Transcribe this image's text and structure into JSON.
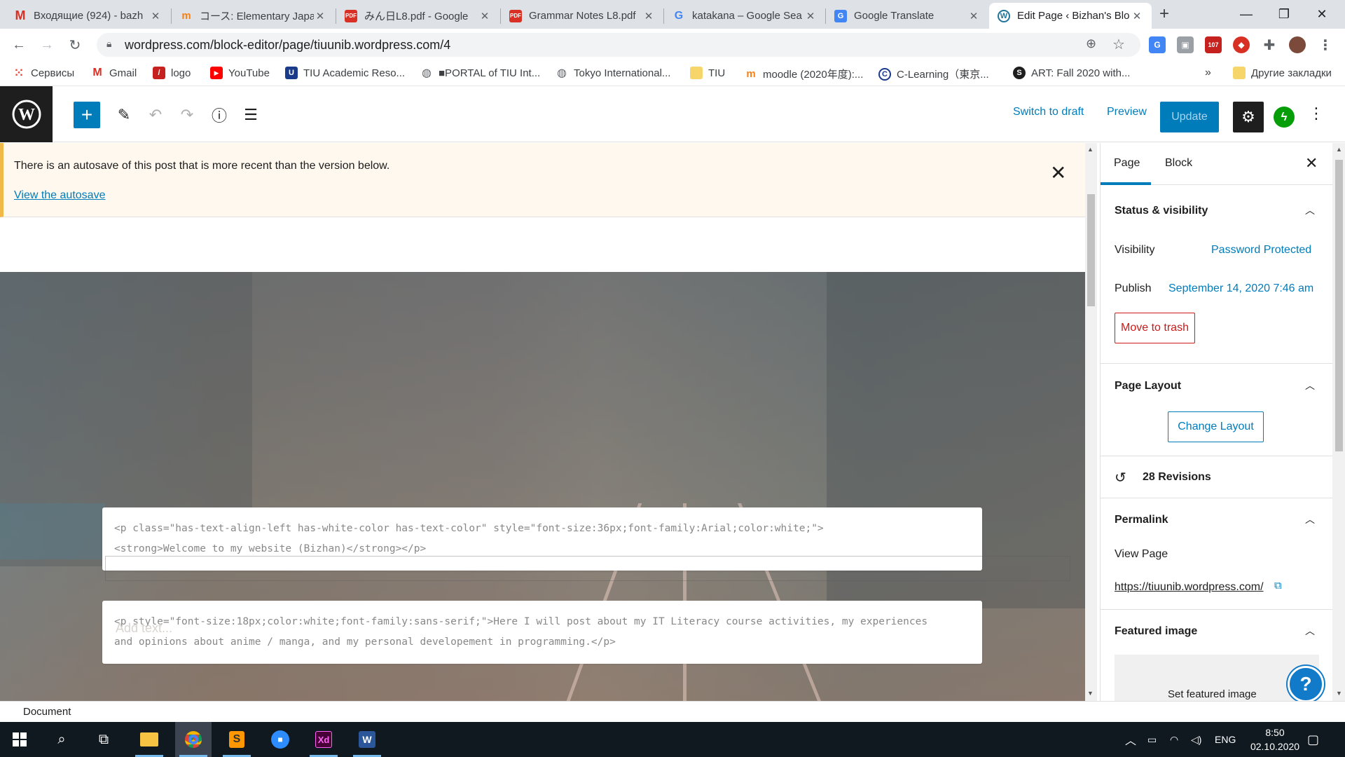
{
  "browser": {
    "tabs": [
      {
        "title": "Входящие (924) - bazh",
        "icon": "gmail-icon",
        "active": false
      },
      {
        "title": "コース: Elementary Japan",
        "icon": "moodle-icon",
        "active": false
      },
      {
        "title": "みん日L8.pdf - Google ",
        "icon": "pdf-icon",
        "active": false
      },
      {
        "title": "Grammar Notes L8.pdf",
        "icon": "pdf-icon",
        "active": false
      },
      {
        "title": "katakana – Google Sea",
        "icon": "google-icon",
        "active": false
      },
      {
        "title": "Google Translate",
        "icon": "translate-icon",
        "active": false
      },
      {
        "title": "Edit Page ‹ Bizhan's Blo",
        "icon": "wordpress-icon",
        "active": true
      }
    ],
    "new_tab_label": "+",
    "url": "wordpress.com/block-editor/page/tiuunib.wordpress.com/4",
    "extension_badge": "107",
    "bookmarks": [
      {
        "label": "Сервисы",
        "icon": "apps-grid-icon"
      },
      {
        "label": "Gmail",
        "icon": "gmail-icon"
      },
      {
        "label": "logo",
        "icon": "logo-icon"
      },
      {
        "label": "YouTube",
        "icon": "youtube-icon"
      },
      {
        "label": "TIU Academic Reso...",
        "icon": "shield-icon"
      },
      {
        "label": "■PORTAL of TIU Int...",
        "icon": "globe-icon"
      },
      {
        "label": "Tokyo International...",
        "icon": "globe-icon"
      },
      {
        "label": "TIU",
        "icon": "folder-icon"
      },
      {
        "label": "moodle (2020年度):...",
        "icon": "moodle-icon"
      },
      {
        "label": "C-Learning（東京...",
        "icon": "clearning-icon"
      },
      {
        "label": "ART: Fall 2020 with...",
        "icon": "s-icon"
      }
    ],
    "bookmarks_overflow": "»",
    "other_bookmarks": "Другие закладки"
  },
  "editor": {
    "toolbar": {
      "switch_to_draft": "Switch to draft",
      "preview": "Preview",
      "update": "Update"
    },
    "notice": {
      "message": "There is an autosave of this post that is more recent than the version below.",
      "link": "View the autosave"
    },
    "blocks": [
      {
        "line1": "<p class=\"has-text-align-left has-white-color has-text-color\" style=\"font-size:36px;font-family:Arial;color:white;\">",
        "line2": "<strong>Welcome to my website (Bizhan)</strong></p>"
      },
      {
        "line1": "<p style=\"font-size:18px;color:white;font-family:sans-serif;\">Here I will post about my IT Literacy course activities, my experiences",
        "line2": "and opinions about anime / manga, and my personal developement in programming.</p>"
      }
    ],
    "cover_placeholder": "Add text...",
    "breadcrumb": "Document"
  },
  "sidebar": {
    "tabs": {
      "page": "Page",
      "block": "Block"
    },
    "status_visibility": {
      "title": "Status & visibility",
      "visibility_label": "Visibility",
      "visibility_value": "Password Protected",
      "publish_label": "Publish",
      "publish_value": "September 14, 2020 7:46 am",
      "trash_button": "Move to trash"
    },
    "page_layout": {
      "title": "Page Layout",
      "button": "Change Layout"
    },
    "revisions": "28 Revisions",
    "permalink": {
      "title": "Permalink",
      "view_page": "View Page",
      "url": "https://tiuunib.wordpress.com/"
    },
    "featured_image": {
      "title": "Featured image",
      "button": "Set featured image"
    }
  },
  "taskbar": {
    "language": "ENG",
    "time": "8:50",
    "date": "02.10.2020"
  },
  "colors": {
    "wp_blue": "#007cba",
    "notice_bg": "#fef8ee",
    "notice_border": "#f0b849",
    "danger": "#cc1818",
    "jetpack_green": "#069e08"
  }
}
